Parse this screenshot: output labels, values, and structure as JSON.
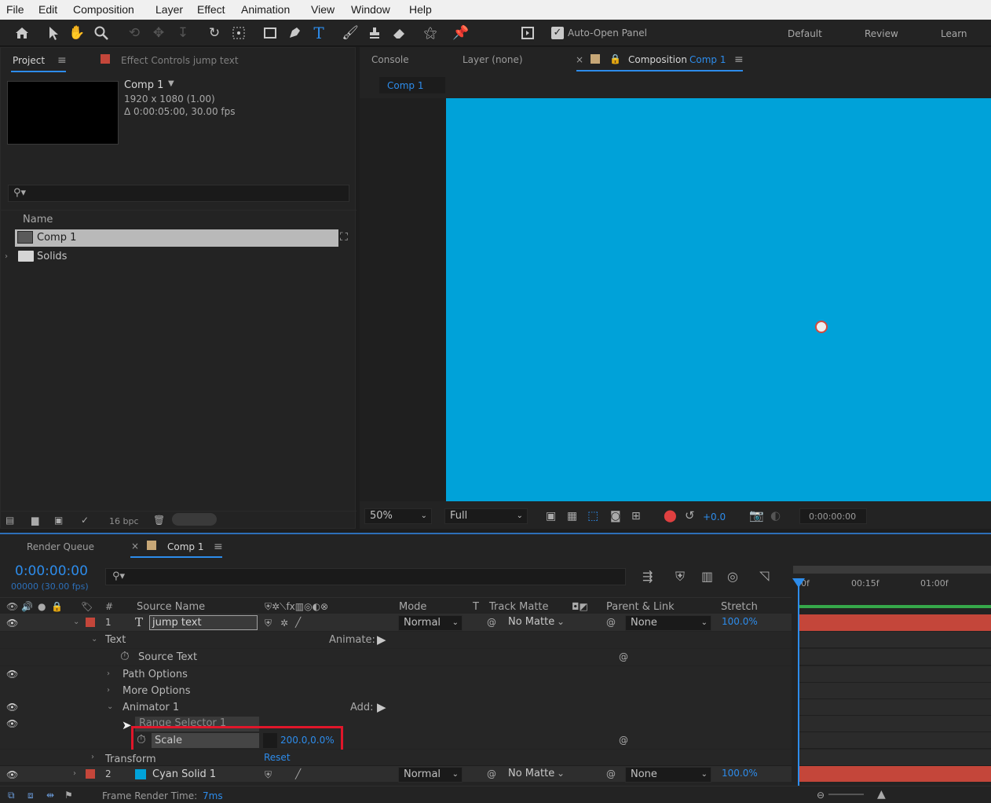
{
  "menu": [
    "File",
    "Edit",
    "Composition",
    "Layer",
    "Effect",
    "Animation",
    "View",
    "Window",
    "Help"
  ],
  "toolbar": {
    "auto_open": "Auto-Open Panel",
    "workspaces": [
      "Default",
      "Review",
      "Learn"
    ]
  },
  "project": {
    "tab": "Project",
    "effect_tab_prefix": "Effect Controls",
    "effect_tab_layer": "jump text",
    "comp_name": "Comp 1",
    "comp_res": "1920 x 1080 (1.00)",
    "comp_dur": "Δ 0:00:05:00, 30.00 fps",
    "col_name": "Name",
    "items": [
      {
        "name": "Comp 1",
        "type": "comp",
        "selected": true
      },
      {
        "name": "Solids",
        "type": "folder",
        "selected": false
      }
    ],
    "bpc": "16 bpc"
  },
  "viewer": {
    "tabs": [
      "Console",
      "Layer (none)"
    ],
    "comp_tab_label": "Composition",
    "comp_tab_name": "Comp 1",
    "breadcrumb": "Comp 1",
    "canvas_color": "#00a2d9",
    "zoom": "50%",
    "resolution": "Full",
    "exposure": "+0.0",
    "timecode": "0:00:00:00"
  },
  "timeline": {
    "tabs": [
      "Render Queue",
      "Comp 1"
    ],
    "timecode": "0:00:00:00",
    "frame_info": "00000 (30.00 fps)",
    "ruler": [
      "0f",
      "00:15f",
      "01:00f"
    ],
    "headers": {
      "num": "#",
      "source": "Source Name",
      "mode": "Mode",
      "t": "T",
      "track": "Track Matte",
      "parent": "Parent & Link",
      "stretch": "Stretch"
    },
    "layers": [
      {
        "num": "1",
        "name": "jump text",
        "color": "#c4463a",
        "mode": "Normal",
        "matte": "No Matte",
        "parent": "None",
        "stretch": "100.0%"
      },
      {
        "num": "2",
        "name": "Cyan Solid 1",
        "color": "#c4463a",
        "mode": "Normal",
        "matte": "No Matte",
        "parent": "None",
        "stretch": "100.0%"
      }
    ],
    "props": {
      "text": "Text",
      "animate": "Animate:",
      "source_text": "Source Text",
      "path_options": "Path Options",
      "more_options": "More Options",
      "animator": "Animator 1",
      "add": "Add:",
      "range_selector": "Range Selector 1",
      "scale": "Scale",
      "scale_value": "200.0,0.0%",
      "transform": "Transform",
      "reset": "Reset"
    },
    "frame_render": "Frame Render Time:",
    "frame_render_val": "7ms"
  }
}
